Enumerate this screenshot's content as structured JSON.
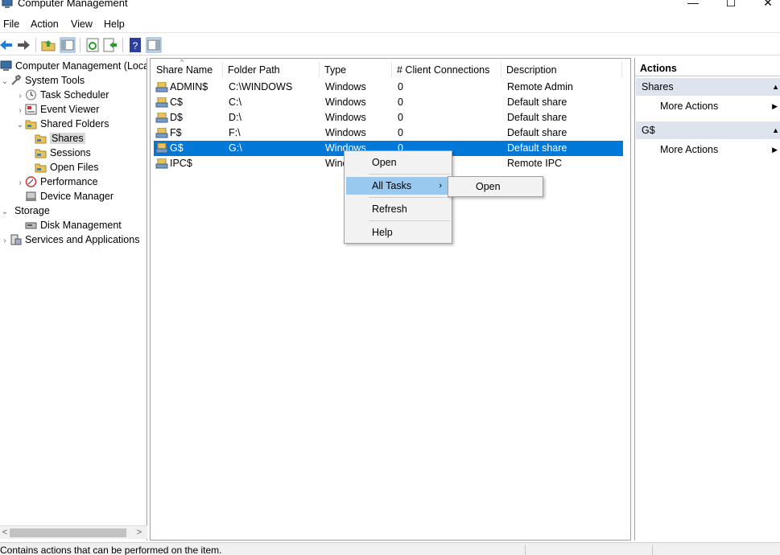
{
  "window": {
    "title": "Computer Management",
    "minimize_glyph": "—",
    "maximize_glyph": "☐",
    "close_glyph": "✕"
  },
  "menu": [
    {
      "label": "File"
    },
    {
      "label": "Action"
    },
    {
      "label": "View"
    },
    {
      "label": "Help"
    }
  ],
  "toolbar": {
    "icons": [
      "back-arrow-icon",
      "forward-arrow-icon",
      "up-folder-icon",
      "show-hide-console-tree-icon",
      "refresh-icon",
      "export-list-icon",
      "help-icon",
      "show-hide-action-pane-icon"
    ]
  },
  "tree": {
    "items": [
      {
        "label": "Computer Management (Local",
        "icon": "computer-icon",
        "expander": ""
      },
      {
        "label": "System Tools",
        "icon": "tools-icon",
        "expander": "⌄"
      },
      {
        "label": "Task Scheduler",
        "icon": "clock-icon",
        "expander": "›"
      },
      {
        "label": "Event Viewer",
        "icon": "event-viewer-icon",
        "expander": "›"
      },
      {
        "label": "Shared Folders",
        "icon": "shared-folder-icon",
        "expander": "⌄"
      },
      {
        "label": "Shares",
        "icon": "shared-folder-icon",
        "expander": ""
      },
      {
        "label": "Sessions",
        "icon": "shared-folder-icon",
        "expander": ""
      },
      {
        "label": "Open Files",
        "icon": "shared-folder-icon",
        "expander": ""
      },
      {
        "label": "Performance",
        "icon": "performance-icon",
        "expander": "›"
      },
      {
        "label": "Device Manager",
        "icon": "device-manager-icon",
        "expander": ""
      },
      {
        "label": "Storage",
        "icon": "storage-icon",
        "expander": "⌄"
      },
      {
        "label": "Disk Management",
        "icon": "disk-icon",
        "expander": ""
      },
      {
        "label": "Services and Applications",
        "icon": "services-icon",
        "expander": "›"
      }
    ],
    "scroll_left": "<",
    "scroll_right": ">"
  },
  "list": {
    "sort_glyph": "^",
    "columns": [
      "Share Name",
      "Folder Path",
      "Type",
      "# Client Connections",
      "Description"
    ],
    "rows": [
      {
        "name": "ADMIN$",
        "path": "C:\\WINDOWS",
        "type": "Windows",
        "connections": "0",
        "description": "Remote Admin"
      },
      {
        "name": "C$",
        "path": "C:\\",
        "type": "Windows",
        "connections": "0",
        "description": "Default share"
      },
      {
        "name": "D$",
        "path": "D:\\",
        "type": "Windows",
        "connections": "0",
        "description": "Default share"
      },
      {
        "name": "F$",
        "path": "F:\\",
        "type": "Windows",
        "connections": "0",
        "description": "Default share"
      },
      {
        "name": "G$",
        "path": "G:\\",
        "type": "Windows",
        "connections": "0",
        "description": "Default share"
      },
      {
        "name": "IPC$",
        "path": "",
        "type": "Wind",
        "connections": "",
        "description": "Remote IPC"
      }
    ]
  },
  "context_menu": {
    "items": [
      "Open",
      "All Tasks",
      "Refresh",
      "Help"
    ],
    "submenu_glyph": "›",
    "submenu": [
      "Open"
    ]
  },
  "actions": {
    "title": "Actions",
    "collapse_glyph": "▲",
    "expand_glyph": "▶",
    "sections": [
      {
        "title": "Shares",
        "items": [
          "More Actions"
        ]
      },
      {
        "title": "G$",
        "items": [
          "More Actions"
        ]
      }
    ]
  },
  "status": {
    "text": "Contains actions that can be performed on the item."
  },
  "colors": {
    "selection": "#0078d7",
    "menu_highlight": "#99c9ef",
    "section_bg": "#dde4ee"
  }
}
